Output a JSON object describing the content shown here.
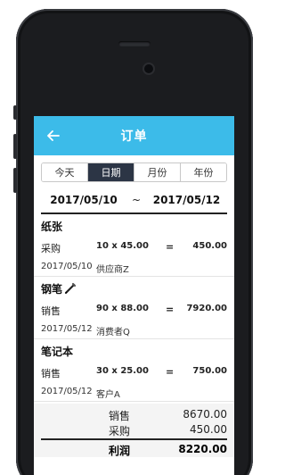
{
  "nav": {
    "title": "订单"
  },
  "tabs": [
    {
      "label": "今天"
    },
    {
      "label": "日期",
      "active": true
    },
    {
      "label": "月份"
    },
    {
      "label": "年份"
    }
  ],
  "date_range": {
    "start": "2017/05/10",
    "separator": "~",
    "end": "2017/05/12"
  },
  "orders": [
    {
      "name": "纸张",
      "type": "采购",
      "qty": "10 x 45.00",
      "eq": "=",
      "amount": "450.00",
      "date": "2017/05/10",
      "party": "供应商Z"
    },
    {
      "name": "钢笔",
      "type": "销售",
      "qty": "90 x 88.00",
      "eq": "=",
      "amount": "7920.00",
      "date": "2017/05/12",
      "party": "消费者Q"
    },
    {
      "name": "笔记本",
      "type": "销售",
      "qty": "30 x 25.00",
      "eq": "=",
      "amount": "750.00",
      "date": "2017/05/12",
      "party": "客户A"
    }
  ],
  "summary": {
    "sales_label": "销售",
    "sales_value": "8670.00",
    "purchase_label": "采购",
    "purchase_value": "450.00",
    "profit_label": "利润",
    "profit_value": "8220.00"
  },
  "colors": {
    "navbar": "#3cbbe9",
    "active_tab": "#2c3545"
  },
  "icons": {
    "back": "arrow-left-icon",
    "pen": "pen-icon"
  }
}
